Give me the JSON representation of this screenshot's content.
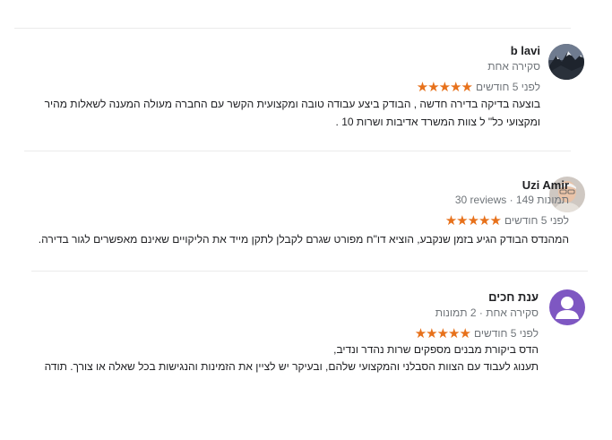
{
  "reviews": [
    {
      "name": "b lavi",
      "meta": "סקירה אחת",
      "stars": "★★★★★",
      "date": "לפני 5 חודשים",
      "lines": [
        "בוצעה בדיקה בדירה חדשה , הבודק ביצע עבודה טובה ומקצועית הקשר עם החברה מעולה    המענה לשאלות מהיר",
        "ומקצועי כל\" ל צוות המשרד אדיבות ושרות 10 ."
      ],
      "avatar_icon": "mountain-photo-avatar"
    },
    {
      "name": "Uzi Amir",
      "meta": "30 reviews · 149 תמונות",
      "stars": "★★★★★",
      "date": "לפני 5 חודשים",
      "lines": [
        "המהנדס הבודק הגיע בזמן שנקבע, הוציא דו\"ח מפורט שגרם לקבלן לתקן מייד את הליקויים שאינם מאפשרים לגור בדירה."
      ],
      "avatar_icon": "person-photo-avatar"
    },
    {
      "name": "ענת חכים",
      "meta": "סקירה אחת · 2 תמונות",
      "stars": "★★★★★",
      "date": "לפני 5 חודשים",
      "lines": [
        "הדס ביקורת מבנים מספקים שרות נהדר ונדיב,",
        "תענוג לעבוד עם הצוות הסבלני והמקצועי שלהם, ובעיקר יש לציין את הזמינות והנגישות בכל שאלה או צורך. תודה"
      ],
      "avatar_icon": "default-user-avatar"
    }
  ],
  "colors": {
    "star": "#e7711b",
    "meta": "#70757a",
    "divider": "#ebebeb",
    "default_avatar": "#7e57c2"
  }
}
